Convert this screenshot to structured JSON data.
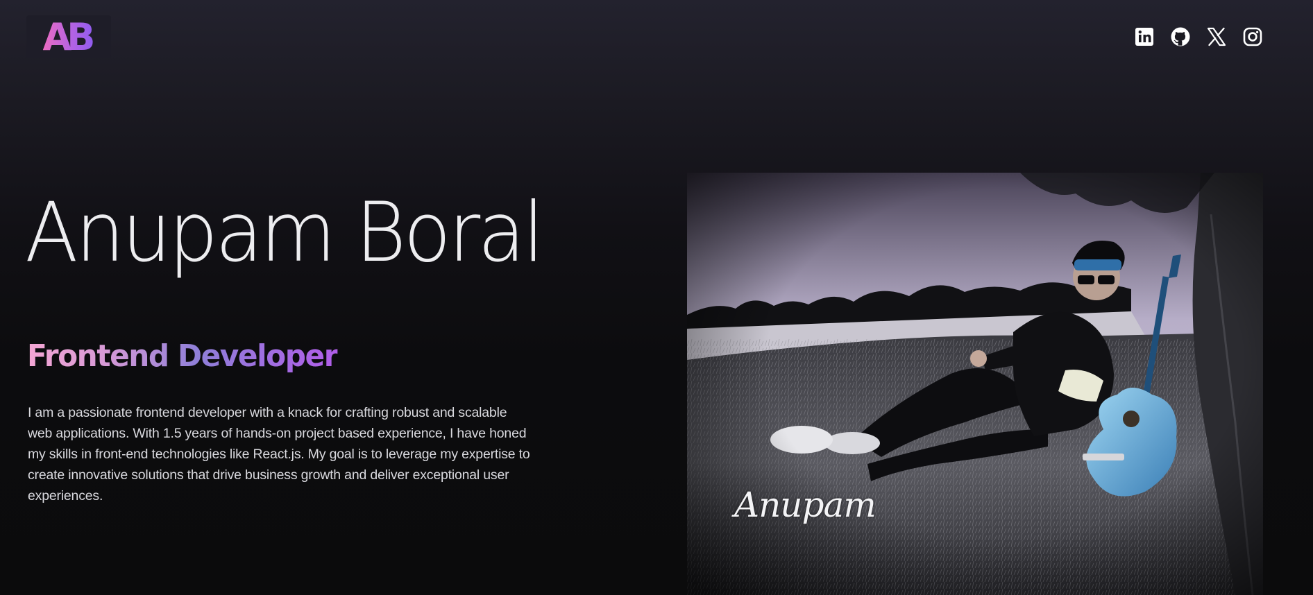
{
  "header": {
    "logo_text": "AB",
    "socials": [
      {
        "name": "linkedin-icon"
      },
      {
        "name": "github-icon"
      },
      {
        "name": "x-icon"
      },
      {
        "name": "instagram-icon"
      }
    ]
  },
  "hero": {
    "name": "Anupam Boral",
    "role": "Frontend Developer",
    "bio": "I am a passionate frontend developer with a knack for crafting robust and scalable web applications. With 1.5 years of hands-on project based experience, I have honed my skills in front-end technologies like React.js. My goal is to leverage my expertise to create innovative solutions that drive business growth and deliver exceptional user experiences."
  },
  "photo": {
    "signature": "Anupam"
  },
  "colors": {
    "accent_pink": "#ec6cc2",
    "accent_purple": "#8f5cf0",
    "background": "#0b0b0d"
  }
}
